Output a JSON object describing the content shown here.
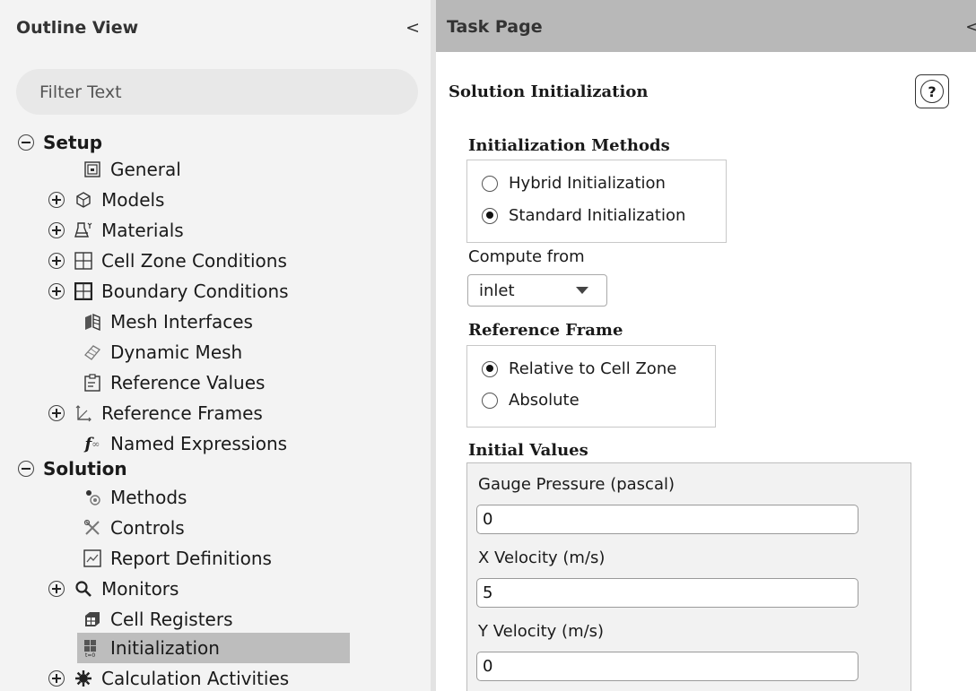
{
  "outline": {
    "title": "Outline View",
    "collapse_glyph": "<",
    "filter_placeholder": "Filter Text",
    "setup_label": "Setup",
    "setup_items": [
      {
        "label": "General",
        "icon": "general-icon",
        "expandable": false
      },
      {
        "label": "Models",
        "icon": "models-icon",
        "expandable": true
      },
      {
        "label": "Materials",
        "icon": "materials-icon",
        "expandable": true
      },
      {
        "label": "Cell Zone Conditions",
        "icon": "cell-zone-icon",
        "expandable": true
      },
      {
        "label": "Boundary Conditions",
        "icon": "boundary-icon",
        "expandable": true
      },
      {
        "label": "Mesh Interfaces",
        "icon": "mesh-interfaces-icon",
        "expandable": false
      },
      {
        "label": "Dynamic Mesh",
        "icon": "dynamic-mesh-icon",
        "expandable": false
      },
      {
        "label": "Reference Values",
        "icon": "reference-values-icon",
        "expandable": false
      },
      {
        "label": "Reference Frames",
        "icon": "reference-frames-icon",
        "expandable": true
      },
      {
        "label": "Named Expressions",
        "icon": "named-expressions-icon",
        "expandable": false
      }
    ],
    "solution_label": "Solution",
    "solution_items": [
      {
        "label": "Methods",
        "icon": "methods-icon",
        "expandable": false
      },
      {
        "label": "Controls",
        "icon": "controls-icon",
        "expandable": false
      },
      {
        "label": "Report Definitions",
        "icon": "report-definitions-icon",
        "expandable": false
      },
      {
        "label": "Monitors",
        "icon": "monitors-icon",
        "expandable": true
      },
      {
        "label": "Cell Registers",
        "icon": "cell-registers-icon",
        "expandable": false
      },
      {
        "label": "Initialization",
        "icon": "initialization-icon",
        "expandable": false,
        "selected": true
      },
      {
        "label": "Calculation Activities",
        "icon": "calculation-activities-icon",
        "expandable": true
      }
    ]
  },
  "task": {
    "title": "Task Page",
    "collapse_glyph": "<",
    "section_title": "Solution Initialization",
    "help_glyph": "?",
    "init_methods": {
      "label": "Initialization Methods",
      "options": [
        "Hybrid  Initialization",
        "Standard Initialization"
      ],
      "selected": "Standard Initialization"
    },
    "compute_from": {
      "label": "Compute from",
      "value": "inlet"
    },
    "reference_frame": {
      "label": "Reference Frame",
      "options": [
        "Relative to Cell Zone",
        "Absolute"
      ],
      "selected": "Relative to Cell Zone"
    },
    "initial_values": {
      "label": "Initial Values",
      "fields": [
        {
          "label": "Gauge Pressure (pascal)",
          "value": "0"
        },
        {
          "label": "X Velocity (m/s)",
          "value": "5"
        },
        {
          "label": "Y Velocity (m/s)",
          "value": "0"
        }
      ]
    }
  },
  "colors": {
    "outline_bg": "#f3f3f3",
    "task_header_bg": "#b8b8b8",
    "selected_row_bg": "#bdbdbd",
    "initial_values_bg": "#f2f2f2"
  }
}
